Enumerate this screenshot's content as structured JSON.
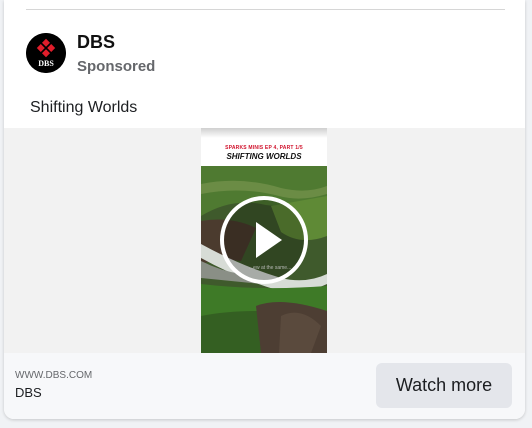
{
  "post": {
    "advertiser": "DBS",
    "sponsored_label": "Sponsored",
    "text": "Shifting Worlds",
    "avatar_logo_text": "DBS"
  },
  "video": {
    "kicker": "SPARKS MINIS EP 4, PART 1/5",
    "title": "SHIFTING WORLDS",
    "caption": "...ew at the same...",
    "play_icon": "play-circle-icon"
  },
  "footer": {
    "domain": "WWW.DBS.COM",
    "name": "DBS",
    "cta_label": "Watch more"
  },
  "colors": {
    "brand_red": "#e11d2b",
    "cta_background": "#e4e6eb",
    "secondary_text": "#65676b"
  }
}
